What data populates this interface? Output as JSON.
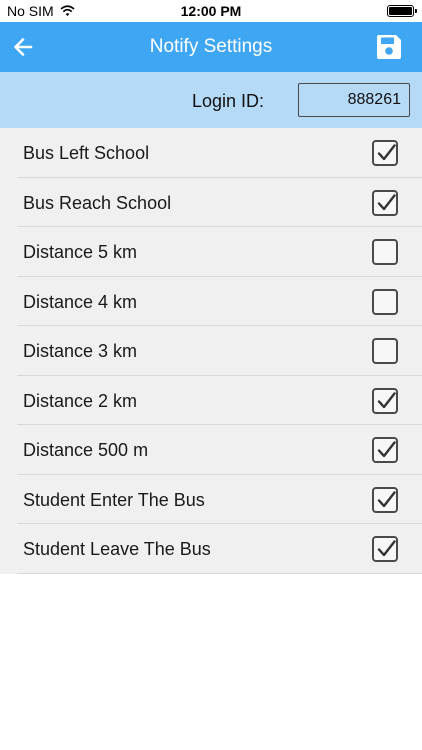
{
  "status_bar": {
    "carrier": "No SIM",
    "time": "12:00 PM",
    "battery_level": 1.0
  },
  "navbar": {
    "title": "Notify Settings",
    "back_icon": "arrow-left-icon",
    "save_icon": "floppy-disk-icon"
  },
  "login": {
    "label": "Login ID:",
    "value": "888261"
  },
  "settings": [
    {
      "label": "Bus Left School",
      "checked": true
    },
    {
      "label": "Bus Reach School",
      "checked": true
    },
    {
      "label": "Distance 5 km",
      "checked": false
    },
    {
      "label": "Distance 4 km",
      "checked": false
    },
    {
      "label": "Distance 3 km",
      "checked": false
    },
    {
      "label": "Distance 2 km",
      "checked": true
    },
    {
      "label": "Distance 500 m",
      "checked": true
    },
    {
      "label": "Student Enter The Bus",
      "checked": true
    },
    {
      "label": "Student Leave The Bus",
      "checked": true
    }
  ],
  "colors": {
    "navbar": "#3ea6f3",
    "login_row": "#b5daf8",
    "list_background": "#f0f0f0"
  }
}
